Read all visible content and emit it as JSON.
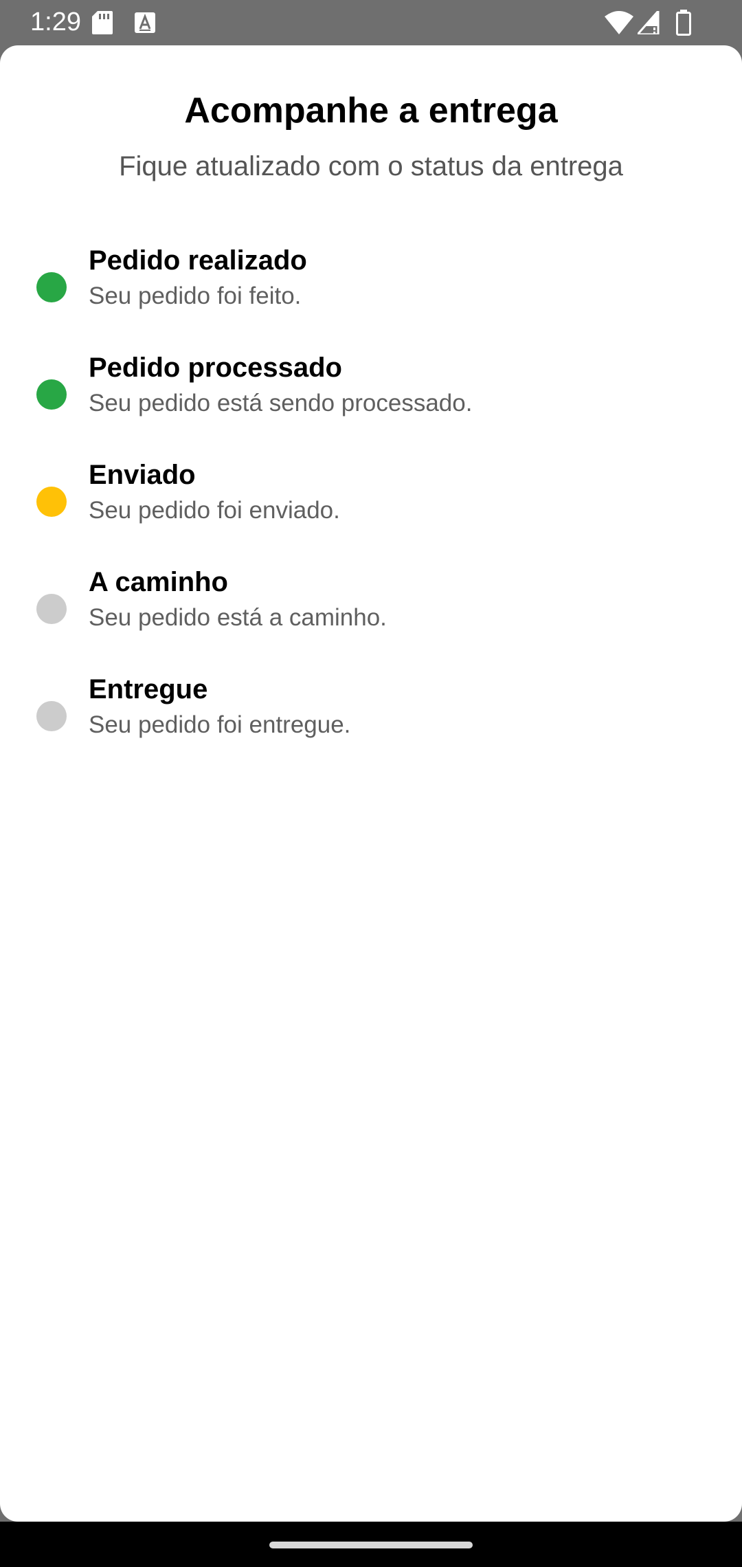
{
  "status_bar": {
    "time": "1:29",
    "icons": [
      "sd-card-icon",
      "text-a-icon",
      "wifi-icon",
      "signal-icon",
      "battery-icon"
    ]
  },
  "header": {
    "title": "Acompanhe a entrega",
    "subtitle": "Fique atualizado com o status da entrega"
  },
  "colors": {
    "completed": "#28a745",
    "current": "#ffc107",
    "pending": "#cccccc"
  },
  "steps": [
    {
      "title": "Pedido realizado",
      "description": "Seu pedido foi feito.",
      "status": "completed"
    },
    {
      "title": "Pedido processado",
      "description": "Seu pedido está sendo processado.",
      "status": "completed"
    },
    {
      "title": "Enviado",
      "description": "Seu pedido foi enviado.",
      "status": "current"
    },
    {
      "title": "A caminho",
      "description": "Seu pedido está a caminho.",
      "status": "pending"
    },
    {
      "title": "Entregue",
      "description": "Seu pedido foi entregue.",
      "status": "pending"
    }
  ]
}
